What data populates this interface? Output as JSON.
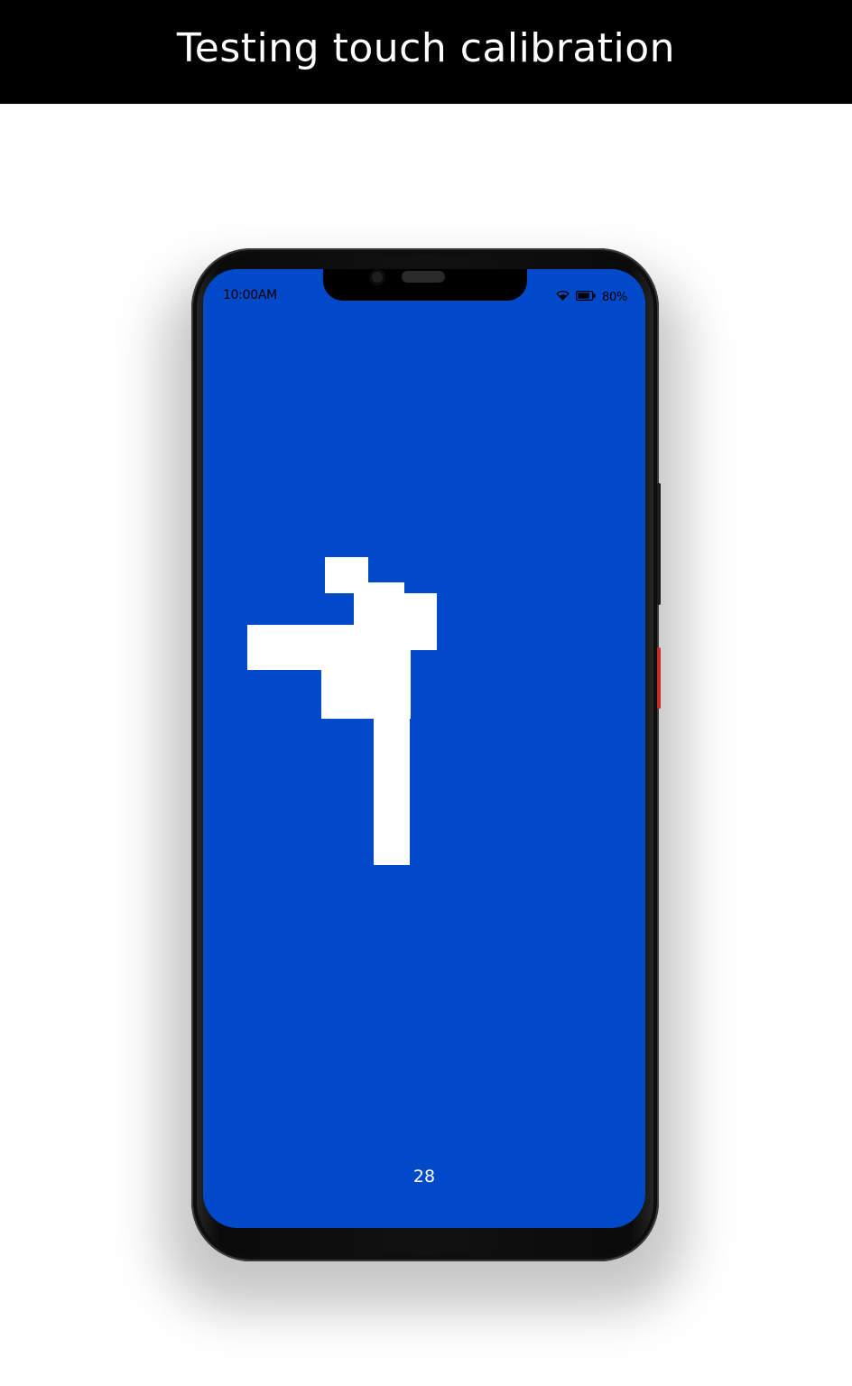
{
  "banner": {
    "title": "Testing touch calibration"
  },
  "status_bar": {
    "time": "10:00AM",
    "battery": "80%",
    "icons": [
      "wifi-icon",
      "battery-icon"
    ]
  },
  "calibration": {
    "counter": "28",
    "screen_color": "#0049c8",
    "trace_color": "#ffffff"
  }
}
